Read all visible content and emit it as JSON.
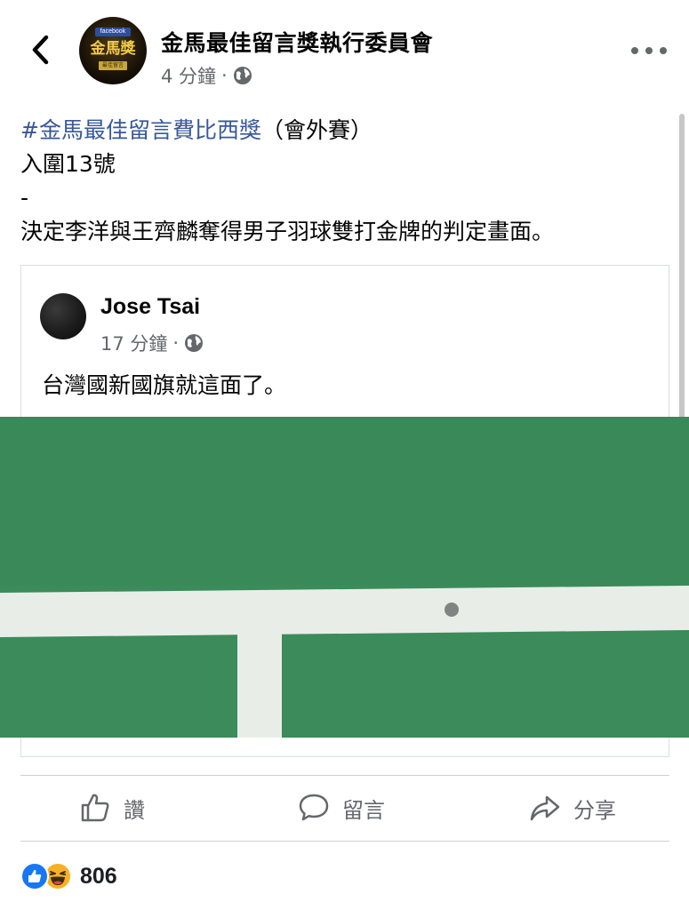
{
  "header": {
    "page_name": "金馬最佳留言獎執行委員會",
    "time": "4 分鐘",
    "separator": "·",
    "avatar_badge_top": "facebook",
    "avatar_badge_main": "金馬獎",
    "avatar_badge_sub": "最佳留言"
  },
  "post": {
    "hashtag": "#金馬最佳留言費比西獎",
    "hashtag_suffix": "（會外賽）",
    "line2": "入圍13號",
    "line3": "-",
    "line4": "決定李洋與王齊麟奪得男子羽球雙打金牌的判定畫面。"
  },
  "shared": {
    "user_name": "Jose Tsai",
    "time": "17 分鐘",
    "separator": "·",
    "text": "台灣國新國旗就這面了。"
  },
  "actions": {
    "like_label": "讚",
    "comment_label": "留言",
    "share_label": "分享"
  },
  "reactions": {
    "count": "806"
  },
  "colors": {
    "court_green": "#3a8a5a",
    "court_line": "#e9efe8",
    "link_blue": "#385898",
    "secondary_text": "#65676b"
  },
  "icons": [
    "back-chevron-icon",
    "more-dots-icon",
    "globe-icon",
    "like-thumb-icon",
    "comment-bubble-icon",
    "share-arrow-icon",
    "like-reaction-icon",
    "haha-reaction-icon"
  ]
}
